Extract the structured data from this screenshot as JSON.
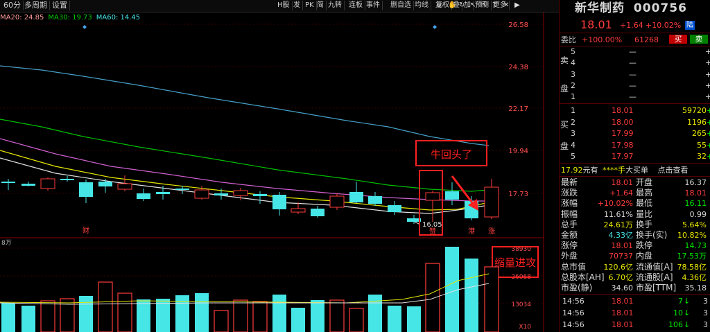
{
  "toolbar": {
    "left": [
      "60分",
      "多周期",
      "设置"
    ],
    "right": [
      "H股",
      "发",
      "PK",
      "简",
      "九转",
      "连板",
      "事件",
      "删自选",
      "均线",
      "复权",
      "叠",
      "加",
      "预测",
      "更多"
    ]
  },
  "ma_labels": [
    {
      "text": "MA20: 24.85",
      "color": "#ff9a9a"
    },
    {
      "text": "MA30: 19.73",
      "color": "#00d000"
    },
    {
      "text": "MA60: 14.45",
      "color": "#46e6e6"
    }
  ],
  "price_axis": [
    "26.58",
    "24.38",
    "22.17",
    "19.94",
    "17.73"
  ],
  "volume_axis": [
    "38930",
    "26068",
    "13034"
  ],
  "volume_unit": "8万",
  "volume_axis_unit": "X10",
  "event_markers": [
    {
      "text": "财",
      "color": "#ff4040"
    },
    {
      "text": "赞",
      "color": "#ff4040"
    },
    {
      "text": "涨",
      "color": "#ff4040"
    },
    {
      "text": "港",
      "color": "#ff4040"
    }
  ],
  "low_price_label": "16.05",
  "annotations": {
    "bull": "牛回头了",
    "volume": "缩量进攻"
  },
  "stock": {
    "name": "新华制药",
    "code": "000756",
    "price": "18.01",
    "change": "+1.64",
    "change_pct": "+10.02%",
    "badge": "陆"
  },
  "weibi": {
    "label": "委比",
    "value": "+100.00%",
    "diff": "61268",
    "buy_btn": "买",
    "sell_btn": "卖"
  },
  "sell_side_label": [
    "卖",
    "盘"
  ],
  "buy_side_label": [
    "买",
    "盘"
  ],
  "sell_levels": [
    {
      "n": "5",
      "price": "—",
      "vol": "",
      "chg": "+"
    },
    {
      "n": "4",
      "price": "—",
      "vol": "",
      "chg": "+"
    },
    {
      "n": "3",
      "price": "—",
      "vol": "",
      "chg": "+"
    },
    {
      "n": "2",
      "price": "—",
      "vol": "",
      "chg": "+"
    },
    {
      "n": "1",
      "price": "—",
      "vol": "",
      "chg": "+"
    }
  ],
  "buy_levels": [
    {
      "n": "1",
      "price": "18.01",
      "vol": "59720"
    },
    {
      "n": "2",
      "price": "18.00",
      "vol": "1196"
    },
    {
      "n": "3",
      "price": "17.99",
      "vol": "265"
    },
    {
      "n": "4",
      "price": "17.98",
      "vol": "55"
    },
    {
      "n": "5",
      "price": "17.97",
      "vol": "32"
    }
  ],
  "big_order": {
    "price": "17.92",
    "text1": "元有",
    "text2": "****手",
    "text3": "大买单",
    "link": "点击查看"
  },
  "stats": [
    {
      "l1": "最新",
      "v1": "18.01",
      "c1": "red",
      "l2": "开盘",
      "v2": "16.37",
      "c2": "white"
    },
    {
      "l1": "涨跌",
      "v1": "+1.64",
      "c1": "red",
      "l2": "最高",
      "v2": "18.01",
      "c2": "red"
    },
    {
      "l1": "涨幅",
      "v1": "+10.02%",
      "c1": "red",
      "l2": "最低",
      "v2": "16.11",
      "c2": "green"
    },
    {
      "l1": "振幅",
      "v1": "11.61%",
      "c1": "white",
      "l2": "量比",
      "v2": "0.99",
      "c2": "white"
    },
    {
      "l1": "总手",
      "v1": "24.61万",
      "c1": "yellow",
      "l2": "换手",
      "v2": "5.64%",
      "c2": "yellow"
    },
    {
      "l1": "金额",
      "v1": "4.33亿",
      "c1": "cyan",
      "l2": "换手(实)",
      "v2": "10.82%",
      "c2": "yellow"
    },
    {
      "l1": "涨停",
      "v1": "18.01",
      "c1": "red",
      "l2": "跌停",
      "v2": "14.73",
      "c2": "green"
    },
    {
      "l1": "外盘",
      "v1": "70737",
      "c1": "red",
      "l2": "内盘",
      "v2": "17.53万",
      "c2": "green"
    },
    {
      "l1": "总市值",
      "v1": "120.6亿",
      "c1": "yellow",
      "l2": "流通值[A]",
      "v2": "78.58亿",
      "c2": "yellow"
    },
    {
      "l1": "总股本[AH]",
      "v1": "6.70亿",
      "c1": "yellow",
      "l2": "流通股[A]",
      "v2": "4.36亿",
      "c2": "yellow"
    },
    {
      "l1": "市盈(静)",
      "v1": "34.60",
      "c1": "white",
      "l2": "市盈[TTM]",
      "v2": "35.18",
      "c2": "white"
    }
  ],
  "ticks": [
    {
      "time": "14:56",
      "price": "18.01",
      "vol": "7",
      "arrow": "↓",
      "extra": "3"
    },
    {
      "time": "14:56",
      "price": "18.01",
      "vol": "10",
      "arrow": "↓",
      "extra": "3"
    },
    {
      "time": "14:56",
      "price": "18.01",
      "vol": "106",
      "arrow": "↓",
      "extra": "3"
    }
  ],
  "colors": {
    "up": "#ff3c3c",
    "down": "#46e6e6",
    "annotation": "#ff2020",
    "ma_yellow": "#e6e600",
    "ma_white": "#e0e0e0"
  }
}
